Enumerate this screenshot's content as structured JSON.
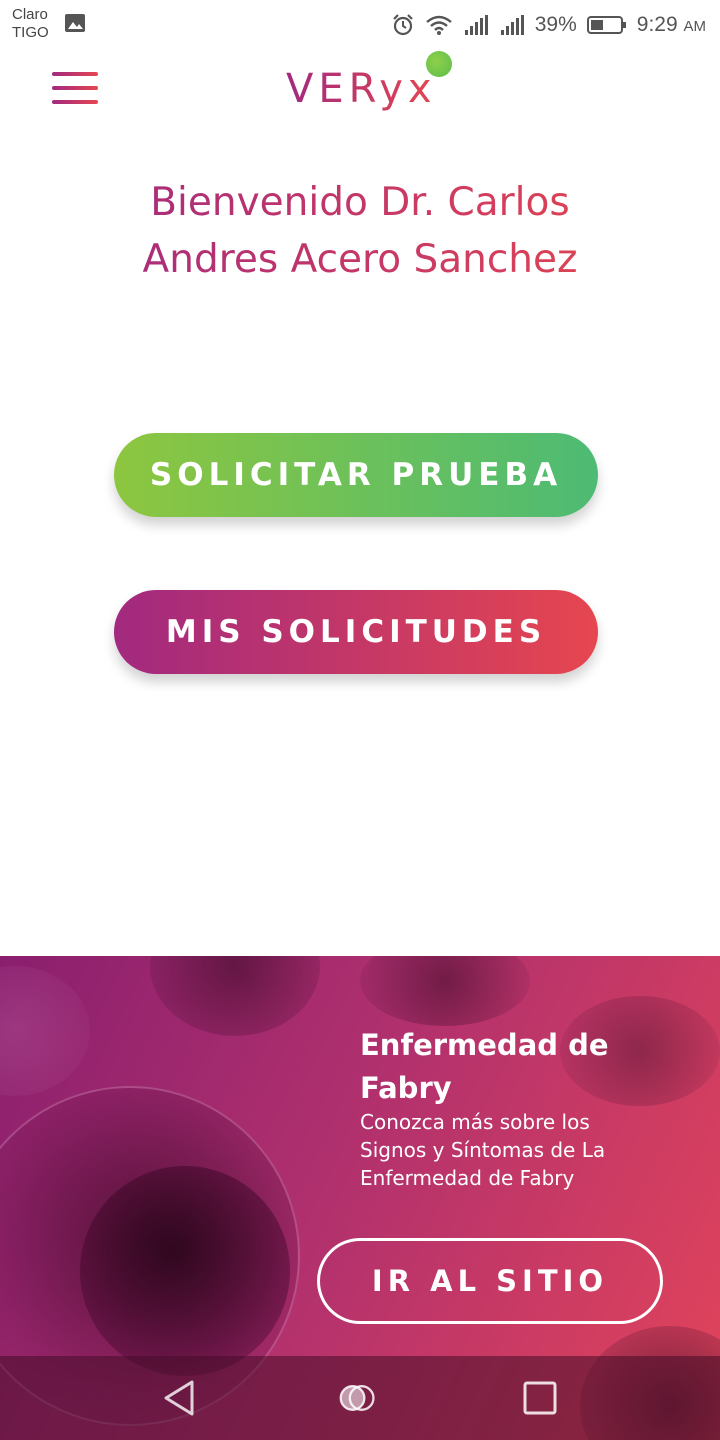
{
  "status_bar": {
    "carrier_line1": "Claro",
    "carrier_line2": "TIGO",
    "battery_percent": "39%",
    "time": "9:29",
    "ampm": "AM",
    "icons": [
      "gallery-icon",
      "alarm-icon",
      "wifi-icon",
      "signal-icon",
      "signal-icon",
      "battery-icon"
    ]
  },
  "header": {
    "logo_text": "VERyx",
    "menu_icon": "hamburger-menu-icon",
    "brand_colors": {
      "primary_start": "#a2297f",
      "primary_end": "#e6464f",
      "accent_green": "#6cc04a"
    }
  },
  "main": {
    "welcome_line1": "Bienvenido Dr. Carlos",
    "welcome_line2": "Andres Acero Sanchez",
    "solicitar_label": "SOLICITAR PRUEBA",
    "mis_solicitudes_label": "MIS SOLICITUDES"
  },
  "banner": {
    "title": "Enfermedad de Fabry",
    "text": "Conozca más sobre los Signos y Síntomas de La Enfermedad de Fabry",
    "button_label": "IR AL SITIO"
  },
  "nav_bar": {
    "icons": [
      "back-icon",
      "home-icon",
      "recent-apps-icon"
    ]
  }
}
